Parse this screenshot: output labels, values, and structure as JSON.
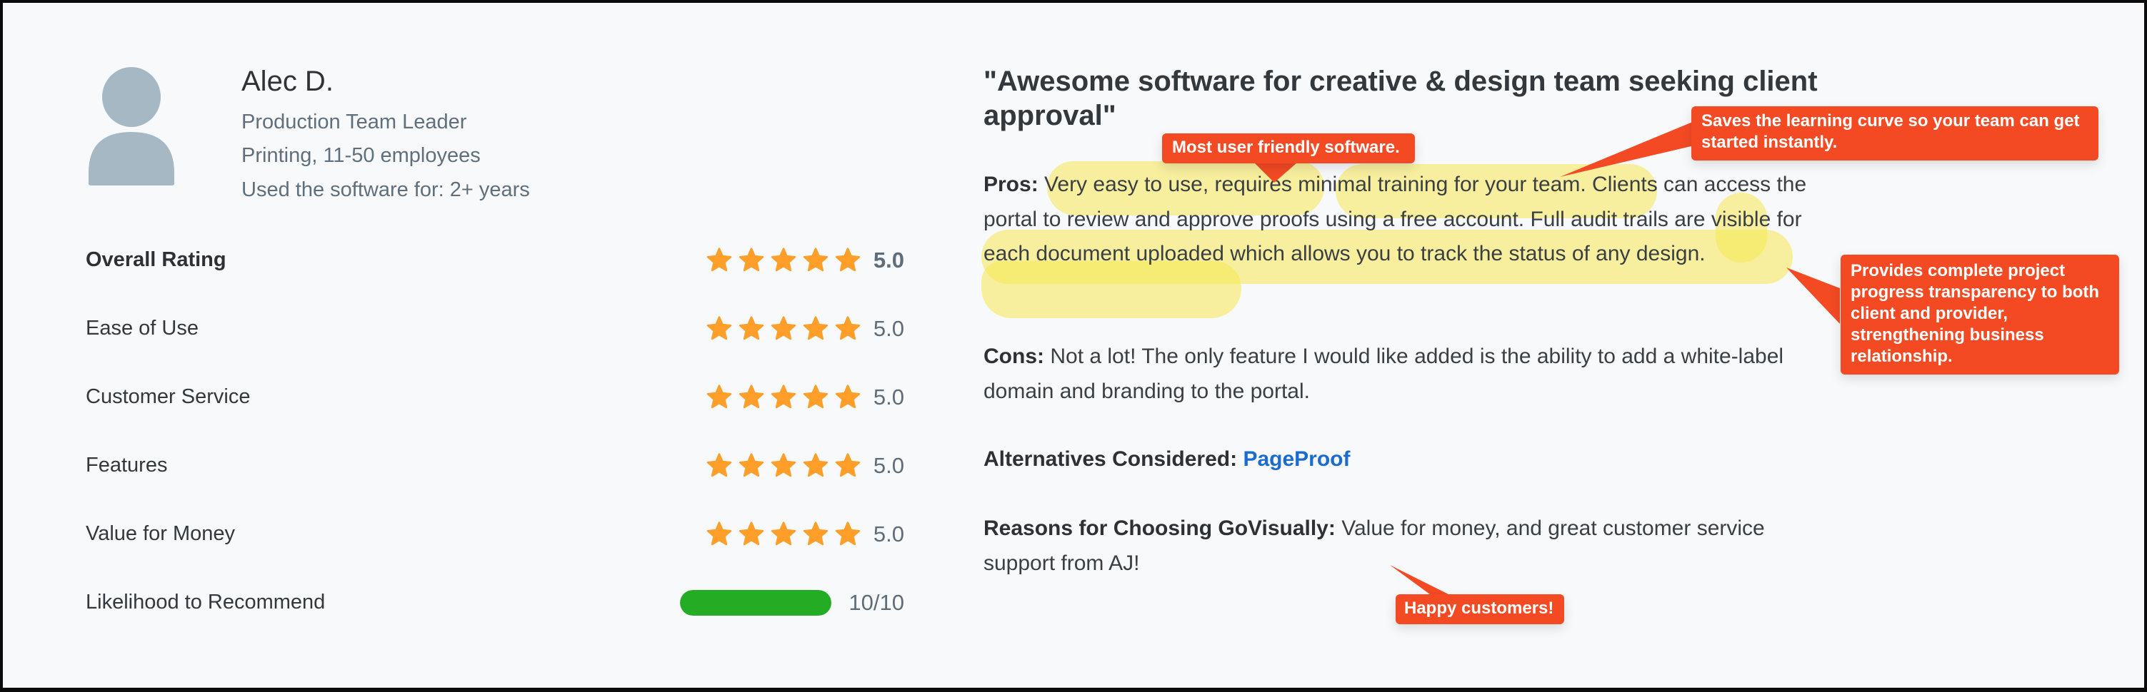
{
  "reviewer": {
    "name": "Alec D.",
    "role": "Production Team Leader",
    "company": "Printing, 11-50 employees",
    "usage": "Used the software for: 2+ years",
    "avatar_icon": "user-silhouette-icon"
  },
  "ratings": [
    {
      "label": "Overall Rating",
      "value": "5.0",
      "stars": 5,
      "bold": true
    },
    {
      "label": "Ease of Use",
      "value": "5.0",
      "stars": 5
    },
    {
      "label": "Customer Service",
      "value": "5.0",
      "stars": 5
    },
    {
      "label": "Features",
      "value": "5.0",
      "stars": 5
    },
    {
      "label": "Value for Money",
      "value": "5.0",
      "stars": 5
    }
  ],
  "recommend": {
    "label": "Likelihood to Recommend",
    "value": "10/10",
    "fraction": 1.0
  },
  "review": {
    "title": "\"Awesome software for creative & design team seeking client approval\"",
    "pros_label": "Pros:",
    "pros_text": "Very easy to use, requires minimal training for your team. Clients can access the portal to review and approve proofs using a free account. Full audit trails are visible for each document uploaded which allows you to track the status of any design.",
    "cons_label": "Cons:",
    "cons_text": "Not a lot! The only feature I would like added is the ability to add a white-label domain and branding to the portal.",
    "alternatives_label": "Alternatives Considered:",
    "alternatives_link": "PageProof",
    "reasons_label": "Reasons for Choosing GoVisually:",
    "reasons_text": "Value for money, and great customer service support from AJ!"
  },
  "callouts": [
    {
      "text": "Most user friendly software."
    },
    {
      "text": "Saves the learning curve so your team can get started instantly."
    },
    {
      "text": "Provides complete project progress transparency to both client and provider, strengthening business relationship."
    },
    {
      "text": "Happy customers!"
    }
  ],
  "colors": {
    "star": "#ff9f2a",
    "progress": "#24ac24",
    "callout": "#f34a24",
    "highlight": "#f5e850",
    "link": "#1a6cd1"
  }
}
